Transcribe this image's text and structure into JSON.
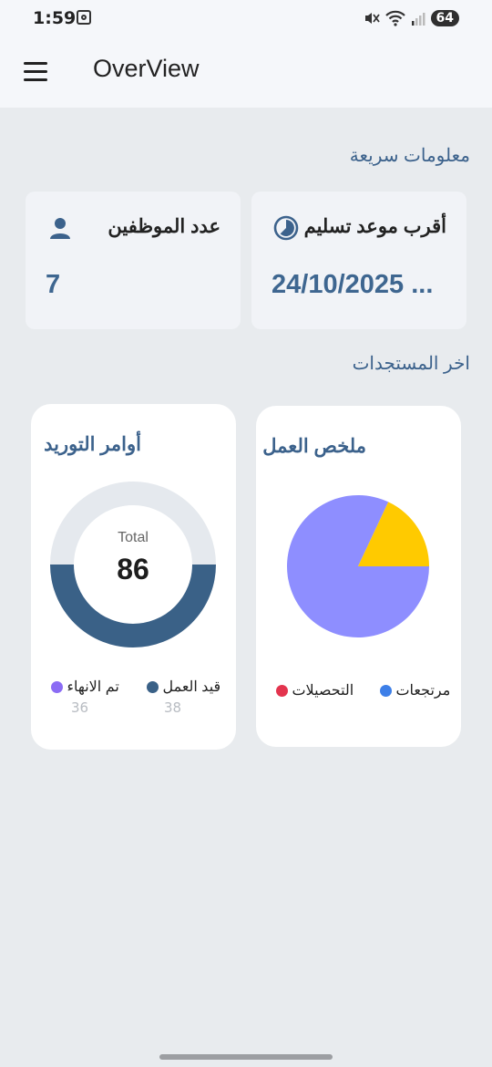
{
  "status_bar": {
    "time": "1:59",
    "battery": "64"
  },
  "app_bar": {
    "title": "OverView"
  },
  "quick_info": {
    "section_title": "معلومات سريعة",
    "nearest_delivery": {
      "label": "أقرب موعد تسليم",
      "value": "24/10/2025 ...",
      "icon": "clock-icon"
    },
    "employee_count": {
      "label": "عدد الموظفين",
      "value": "7",
      "icon": "person-icon"
    }
  },
  "latest": {
    "section_title": "اخر المستجدات"
  },
  "work_summary": {
    "title": "ملخص العمل",
    "legend": [
      {
        "label": "مرتجعات",
        "color": "#3d7fe8"
      },
      {
        "label": "التحصيلات",
        "color": "#e3344e"
      }
    ]
  },
  "supply_orders": {
    "title": "أوامر التوريد",
    "center_label": "Total",
    "center_value": "86",
    "legend": [
      {
        "label": "قيد العمل",
        "count": "38",
        "color": "#3a6187"
      },
      {
        "label": "تم الانهاء",
        "count": "36",
        "color": "#8b6cf4"
      }
    ]
  },
  "chart_data": [
    {
      "type": "pie",
      "title": "ملخص العمل",
      "slices": [
        {
          "name": "",
          "value": 0.82,
          "color": "#8e8eff"
        },
        {
          "name": "",
          "value": 0.18,
          "color": "#ffca00"
        }
      ],
      "legend": [
        "مرتجعات",
        "التحصيلات"
      ]
    },
    {
      "type": "donut",
      "title": "أوامر التوريد",
      "total": 86,
      "segments": [
        {
          "name": "قيد العمل",
          "value": 38,
          "color": "#3a6187"
        },
        {
          "name": "remainder",
          "value": 0.5,
          "color": "#e5e9ee"
        }
      ]
    }
  ]
}
